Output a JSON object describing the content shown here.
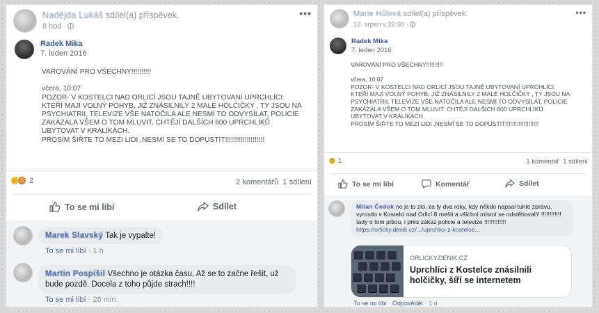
{
  "left_post": {
    "sharer_name": "Nadějda Lukáš",
    "shared_text": "sdílel(a) příspěvek.",
    "time": "8 hod ·",
    "more": "•••",
    "author_name": "Radek Mika",
    "author_date": "7. leden 2016",
    "body": "VAROVÁNÍ PRO VŠECHNY!!!!!!!!!!\n\nvčera, 10:07\nPOZOR- V KOSTELCI NAD ORLICÍ JSOU TAJNĚ UBYTOVANÍ UPRCHLÍCI\nKTEŘÍ MAJÍ VOLNÝ POHYB, JIŽ ZNÁSILNILY 2 MALÉ HOLČIČKY , TY JSOU NA\nPSYCHIATRII, TELEVIZE VŠE NATOČILA ALE NESMÍ TO ODVYSÍLAT, POLICIE\nZAKÁZALA VŠEM O TOM MLUVIT. CHTĚJÍ DALŠÍCH 600 UPRCHLÍKŮ\nUBYTOVAT V KRÁLÍKÁCH.\nPROSÍM ŠIŘTE TO MEZI LIDI ,NESMÍ SE TO DOPUSTIT!!!!!!!!!!!!!!!!!!!!",
    "reaction_count": "2",
    "counts_text": "2 komentářů  1 sdílení",
    "like_label": "To se mi líbí",
    "share_label": "Sdílet",
    "comments": [
      {
        "name": "Marek Slavský",
        "text": "Tak je vypalte!",
        "meta_like": "To se mi líbí",
        "meta_time": " · 1 h"
      },
      {
        "name": "Martin Pospíšil",
        "text": "Všechno je otázka času. Až se to začne řešit, už bude pozdě. Docela z toho půjde strach!!!!",
        "meta_like": "To se mi líbí",
        "meta_time": " · 26 min."
      }
    ]
  },
  "right_post": {
    "sharer_name": "Marie Hůlová",
    "shared_text": "sdílel(a) příspěvek.",
    "time": "12. srpen v 22:30 ·",
    "more": "•••",
    "author_name": "Radek Mika",
    "author_date": "7. leden 2016",
    "body": "VAROVÁNÍ PRO VŠECHNY!!!!!!!!!!\n\nvčera, 10:07\nPOZOR- V KOSTELCI NAD ORLICÍ JSOU TAJNĚ UBYTOVANÍ UPRCHLÍCI\nKTEŘÍ MAJÍ VOLNÝ POHYB, JIŽ ZNÁSILNILY 2 MALÉ HOLČIČKY , TY JSOU NA\nPSYCHIATRII, TELEVIZE VŠE NATOČILA ALE NESMÍ TO ODVYSÍLAT, POLICIE\nZAKÁZALA VŠEM O TOM MLUVIT. CHTĚJÍ DALŠÍCH 600 UPRCHLÍKŮ\nUBYTOVAT V KRÁLÍKÁCH.\nPROSÍM ŠIŘTE TO MEZI LIDI ,NESMÍ SE TO DOPUSTIT!!!!!!!!!!!!!!!!!!!!",
    "reaction_count": "1",
    "counts_text": "1 komentář  1 sdílení",
    "like_label": "To se mi líbí",
    "comment_label": "Komentář",
    "share_label": "Sdílet",
    "comment": {
      "name": "Milan Čedok",
      "text": "no je to zlo, za ty dva roky, kdy někdo napsal tuhle zprávu, vyrostlo v Kostelci nad Orlicí 8 mešit a všichni místní se odstěhovalY !!!!!!!!!!!! tady o tom píšou, i přes zákaz policie a televize !!!!!!!!!!!!!",
      "link": "https://orlicky.denik.cz/.../uprchlici-z-kostelce...",
      "preview_domain": "ORLICKY.DENIK.CZ",
      "preview_title": "Uprchlíci z Kostelce znásilnili holčičky, šíří se internetem",
      "meta_like": "To se mi líbí",
      "meta_reply": "Odpovědět",
      "meta_time": "1 d"
    }
  },
  "colors": {
    "link_blue": "#385898",
    "muted_gray": "#90949c",
    "comment_bubble": "#e9ebee"
  },
  "icons": [
    "globe-icon",
    "more-icon",
    "like-icon",
    "comment-icon",
    "share-icon",
    "haha-emoji-icon",
    "angry-emoji-icon",
    "sad-emoji-icon"
  ]
}
